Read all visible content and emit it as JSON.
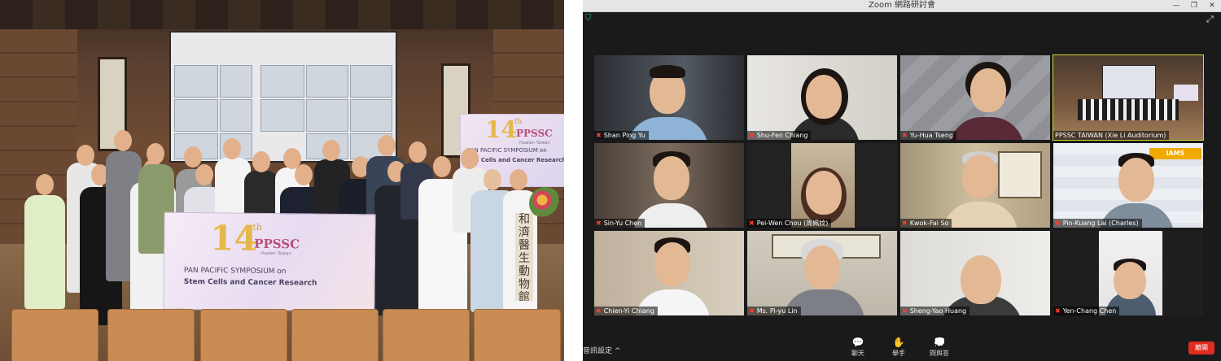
{
  "photo": {
    "banner_front": {
      "number": "14",
      "number_suffix": "th",
      "brand": "PPSSC",
      "location": "Hualien Taiwan",
      "line1": "PAN PACIFIC SYMPOSIUM on",
      "line2": "Stem Cells and Cancer Research"
    },
    "banner_side": {
      "number": "14",
      "number_suffix": "th",
      "brand": "PPSSC",
      "location": "Hualien Taiwan",
      "line1": "PAN PACIFIC SYMPOSIUM on",
      "line2": "Stem Cells and Cancer Research"
    },
    "vertical_sign": "和 濟 醫 生 動 物 館"
  },
  "zoom": {
    "window_title": "Zoom 網路研討會",
    "controls": {
      "minimize": "—",
      "maximize": "❐",
      "close": "✕"
    },
    "participants": [
      {
        "name": "Shan Ping Yu",
        "bg": "#3b3f46",
        "active": false
      },
      {
        "name": "Shu-Fen Chiang",
        "bg": "#d9d6d0",
        "active": false
      },
      {
        "name": "Yu-Hua Tseng",
        "bg": "#8e9096",
        "active": false
      },
      {
        "name": "PPSSC TAIWAN (Xie Li Auditorium)",
        "bg": "#6b5a48",
        "active": true
      },
      {
        "name": "Sin-Yu Chen",
        "bg": "#5b5048",
        "active": false
      },
      {
        "name": "Pei-Wen Chou (周姵妏)",
        "bg": "#222222",
        "active": false
      },
      {
        "name": "Kwok-Fai So",
        "bg": "#b7a68c",
        "active": false
      },
      {
        "name": "Pin-Kuang Lai (Charles)",
        "bg": "#e7e9ee",
        "active": false
      },
      {
        "name": "Chien-Yi Chiang",
        "bg": "#c7b9a5",
        "active": false
      },
      {
        "name": "Ms. Pi-yu Lin",
        "bg": "#c9c3b8",
        "active": false
      },
      {
        "name": "Sheng-Yao Huang",
        "bg": "#e2e1de",
        "active": false
      },
      {
        "name": "Yen-Chang Chen",
        "bg": "#1f1f1f",
        "active": false
      }
    ],
    "sponsor_banner": "IAMS",
    "bottom": {
      "audio_settings": "音訊設定",
      "chat": "聊天",
      "raise_hand": "舉手",
      "qa": "問與答",
      "leave": "離開"
    }
  }
}
